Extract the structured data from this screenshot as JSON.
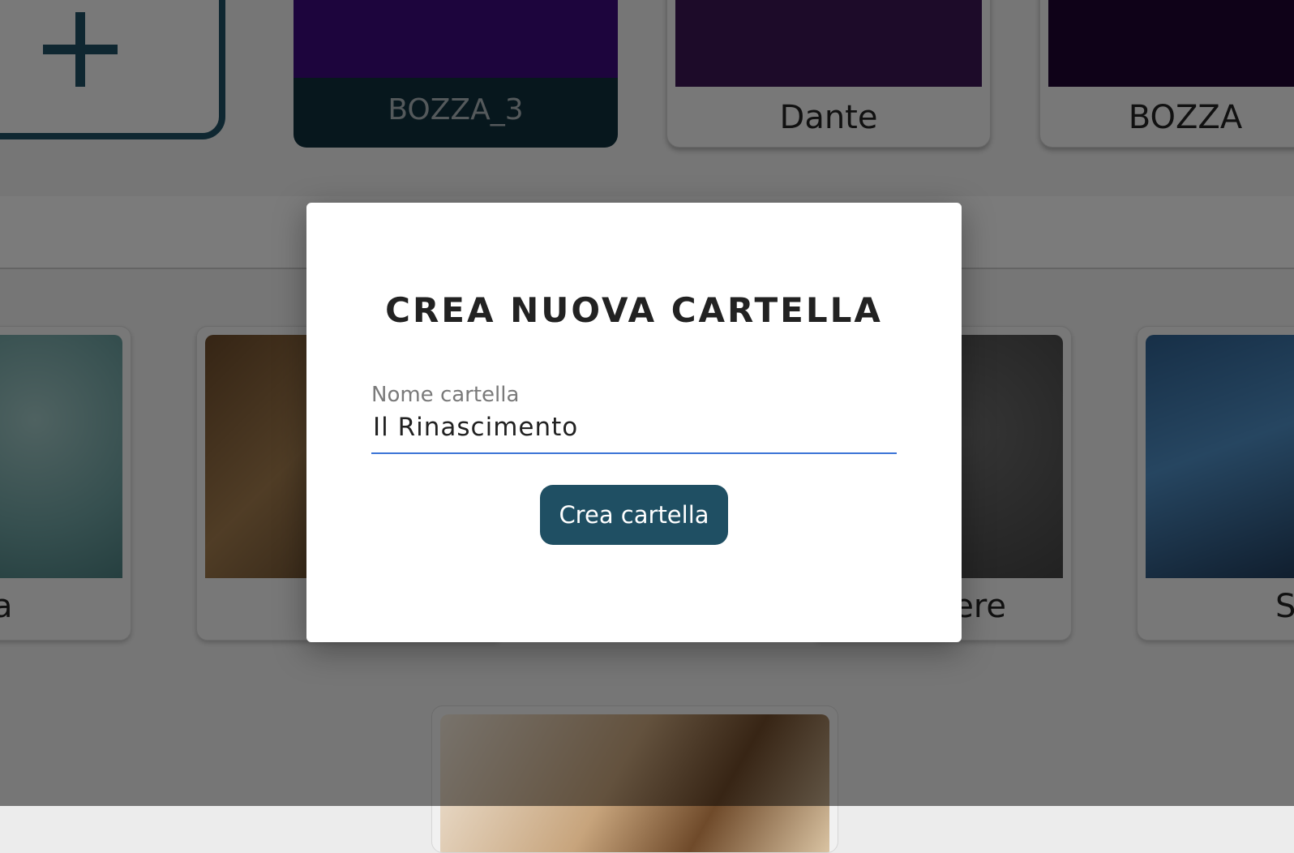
{
  "top_cards": {
    "add_symbol": "+",
    "drafts": [
      {
        "name": "BOZZA_3",
        "color": "#3a0a7a"
      },
      {
        "name": "Dante",
        "color": "#3b1652"
      },
      {
        "name": "BOZZA",
        "color": "#1e0530"
      }
    ]
  },
  "folders": [
    {
      "label": "a"
    },
    {
      "label": ""
    },
    {
      "label": "ere"
    },
    {
      "label": "S"
    }
  ],
  "modal": {
    "title": "CREA NUOVA CARTELLA",
    "field_label": "Nome cartella",
    "field_value": "Il Rinascimento",
    "button_label": "Crea cartella"
  },
  "colors": {
    "accent": "#1f4f63",
    "input_underline": "#3b74d6"
  }
}
